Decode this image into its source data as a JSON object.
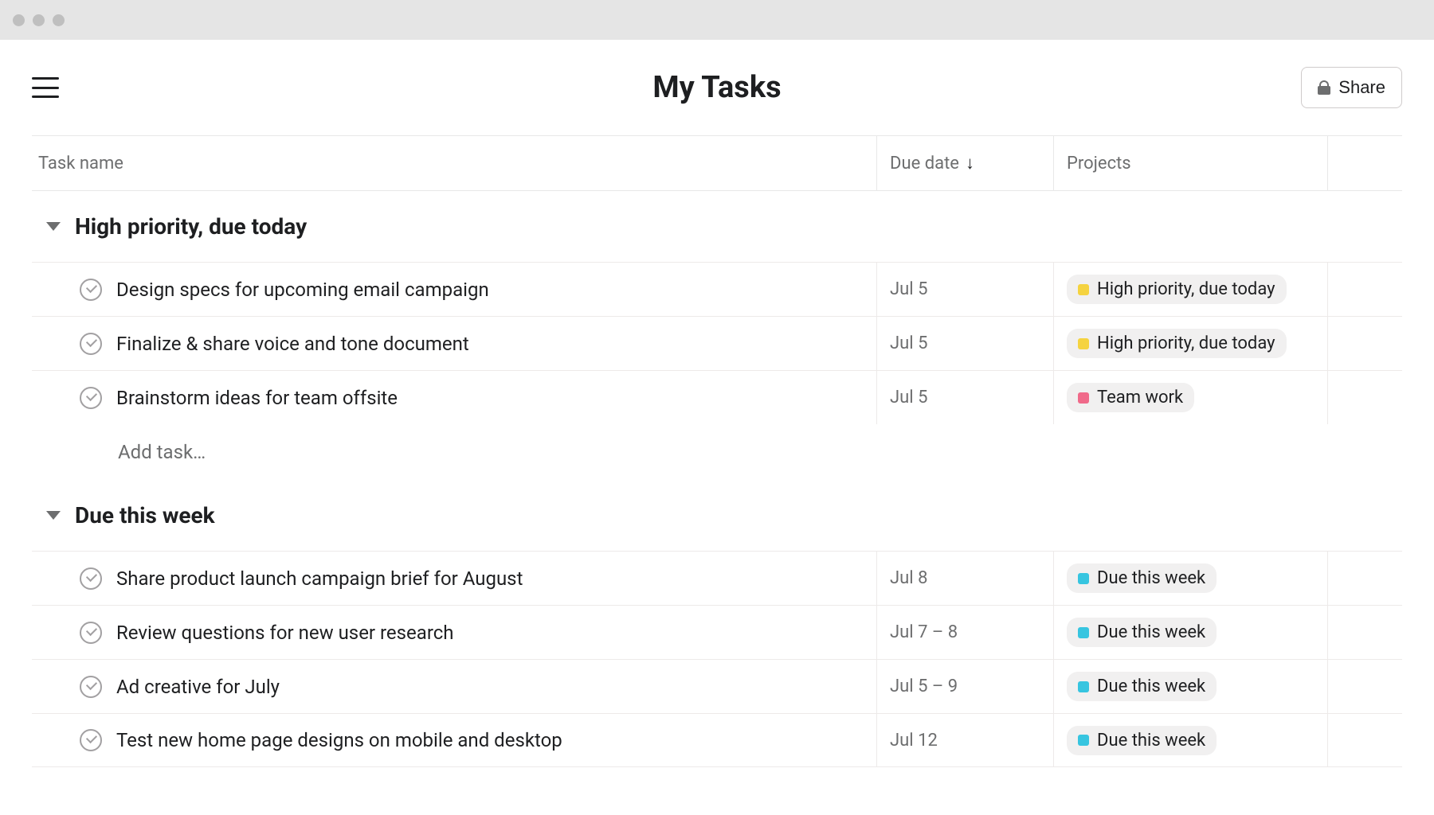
{
  "header": {
    "title": "My Tasks",
    "share_label": "Share"
  },
  "columns": {
    "task_name": "Task name",
    "due_date": "Due date",
    "projects": "Projects"
  },
  "add_task_placeholder": "Add task…",
  "sections": [
    {
      "title": "High priority, due today",
      "tasks": [
        {
          "name": "Design specs for upcoming email campaign",
          "due": "Jul 5",
          "project_label": "High priority, due today",
          "project_color": "yellow"
        },
        {
          "name": "Finalize & share voice and tone document",
          "due": "Jul 5",
          "project_label": "High priority, due today",
          "project_color": "yellow"
        },
        {
          "name": "Brainstorm ideas for team offsite",
          "due": "Jul 5",
          "project_label": "Team work",
          "project_color": "pink"
        }
      ],
      "show_add": true
    },
    {
      "title": "Due this week",
      "tasks": [
        {
          "name": "Share product launch campaign brief for August",
          "due": "Jul 8",
          "project_label": "Due this week",
          "project_color": "cyan"
        },
        {
          "name": "Review questions for new user research",
          "due": "Jul 7 – 8",
          "project_label": "Due this week",
          "project_color": "cyan"
        },
        {
          "name": "Ad creative for July",
          "due": "Jul 5 – 9",
          "project_label": "Due this week",
          "project_color": "cyan"
        },
        {
          "name": "Test new home page designs on mobile and desktop",
          "due": "Jul 12",
          "project_label": "Due this week",
          "project_color": "cyan"
        }
      ],
      "show_add": false
    }
  ]
}
